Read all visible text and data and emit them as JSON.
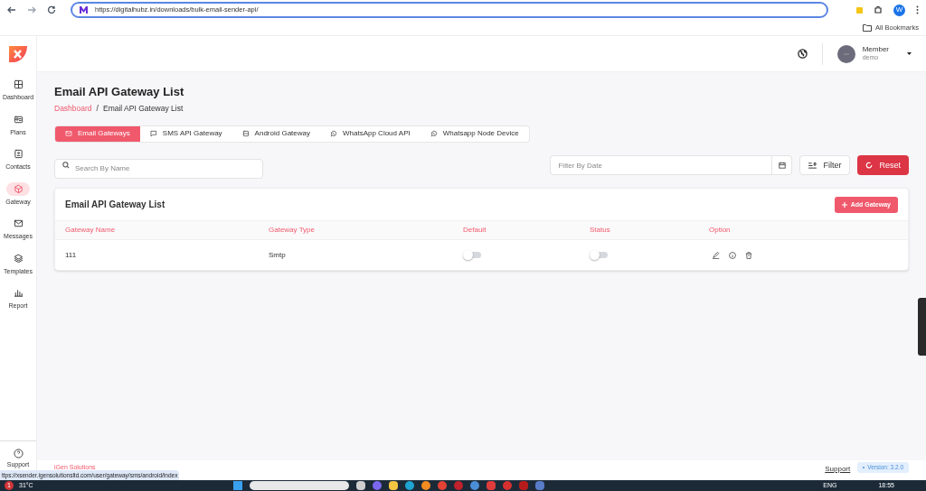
{
  "browser": {
    "url": "https://digitalhubz.in/downloads/bulk-email-sender-api/",
    "profile_initial": "W",
    "bookmarks_label": "All Bookmarks"
  },
  "header": {
    "user_name": "Member",
    "user_role": "demo"
  },
  "sidebar": {
    "items": [
      {
        "label": "Dashboard",
        "selected": false
      },
      {
        "label": "Plans",
        "selected": false
      },
      {
        "label": "Contacts",
        "selected": false
      },
      {
        "label": "Gateway",
        "selected": true
      },
      {
        "label": "Messages",
        "selected": false
      },
      {
        "label": "Templates",
        "selected": false
      },
      {
        "label": "Report",
        "selected": false
      }
    ],
    "support_label": "Support"
  },
  "page_title": "Email API Gateway List",
  "breadcrumb": [
    {
      "label": "Dashboard",
      "link": true
    },
    {
      "label": "Email API Gateway List",
      "link": false
    }
  ],
  "breadcrumb_separator": "/",
  "tabs": [
    {
      "label": "Email Gateways",
      "selected": true
    },
    {
      "label": "SMS API Gateway",
      "selected": false
    },
    {
      "label": "Android Gateway",
      "selected": false
    },
    {
      "label": "WhatsApp Cloud API",
      "selected": false
    },
    {
      "label": "Whatsapp Node Device",
      "selected": false
    }
  ],
  "search": {
    "placeholder": "Search By Name"
  },
  "date_filter": {
    "placeholder": "Filter By Date"
  },
  "filter_button": "Filter",
  "reset_button": "Reset",
  "card": {
    "title": "Email API Gateway List",
    "add_button": "Add Gateway",
    "columns": [
      "Gateway Name",
      "Gateway Type",
      "Default",
      "Status",
      "Option"
    ],
    "rows": [
      {
        "name": "111",
        "type": "Smtp",
        "default": false,
        "status": false
      }
    ]
  },
  "footer": {
    "brand": "iGen Solutions",
    "support_link": "Support",
    "version": "Version: 3.2.0"
  },
  "status_url": "ttps://xsender.igensolutionsltd.com/user/gateway/sms/android/index",
  "taskbar": {
    "weather_badge": "1",
    "temperature": "31°C",
    "language": "ENG",
    "time": "18:55"
  }
}
